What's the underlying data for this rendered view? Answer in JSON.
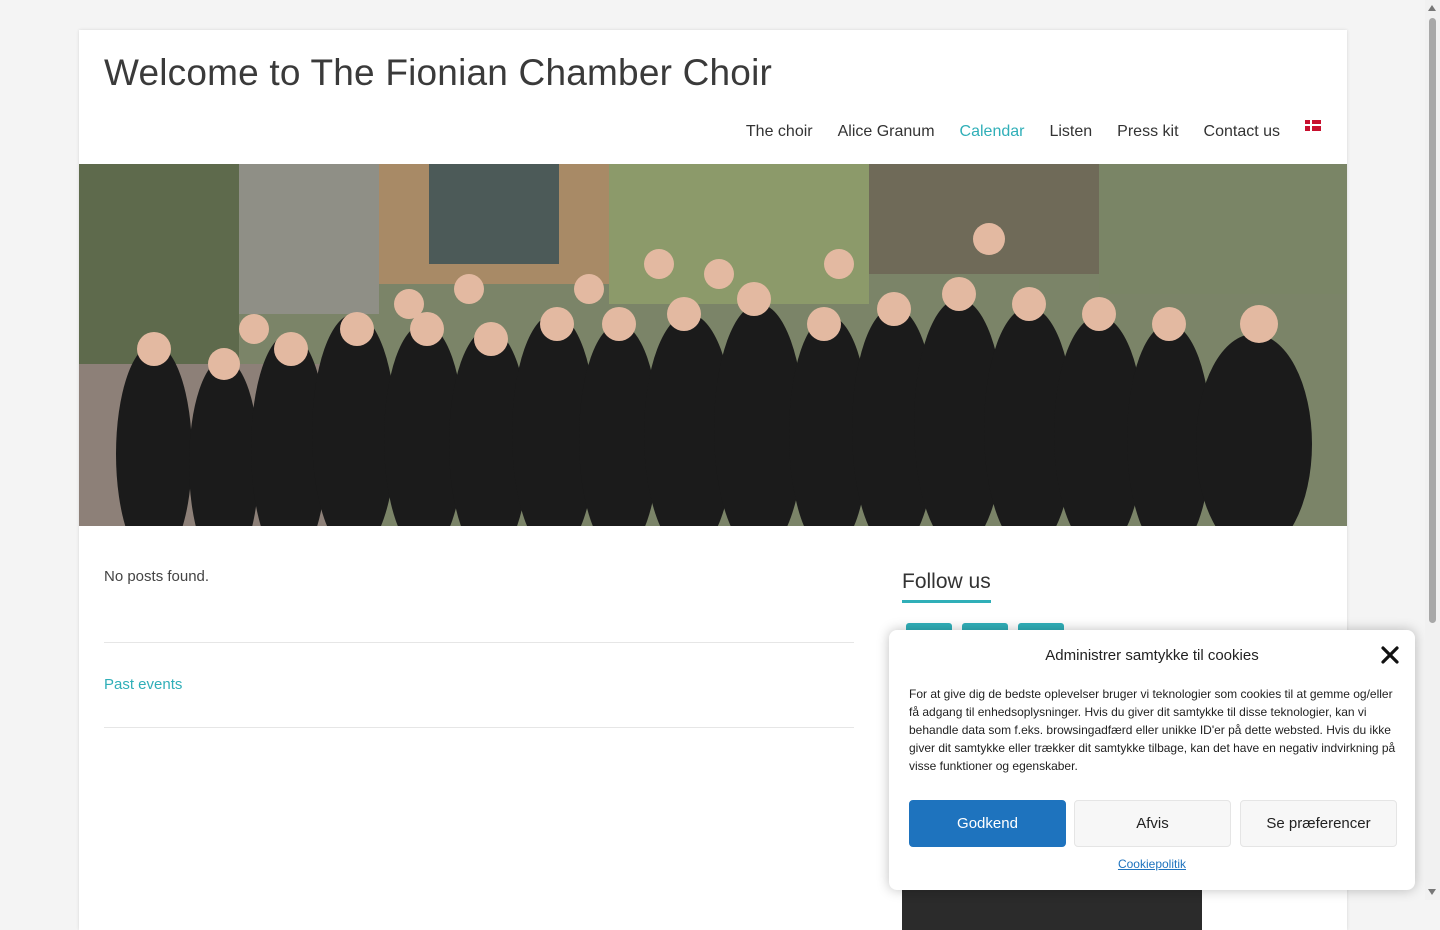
{
  "site": {
    "title": "Welcome to The Fionian Chamber Choir"
  },
  "nav": {
    "items": [
      {
        "label": "The choir"
      },
      {
        "label": "Alice Granum"
      },
      {
        "label": "Calendar",
        "active": true
      },
      {
        "label": "Listen"
      },
      {
        "label": "Press kit"
      },
      {
        "label": "Contact us"
      }
    ],
    "language_flag": "danish-flag-icon"
  },
  "main": {
    "no_posts": "No posts found.",
    "past_events": "Past events"
  },
  "sidebar": {
    "follow_title": "Follow us",
    "social_icons": [
      "facebook-icon",
      "instagram-icon",
      "youtube-icon"
    ]
  },
  "cookie": {
    "title": "Administrer samtykke til cookies",
    "text": "For at give dig de bedste oplevelser bruger vi teknologier som cookies til at gemme og/eller få adgang til enhedsoplysninger. Hvis du giver dit samtykke til disse teknologier, kan vi behandle data som f.eks. browsingadfærd eller unikke ID'er på dette websted. Hvis du ikke giver dit samtykke eller trækker dit samtykke tilbage, kan det have en negativ indvirkning på visse funktioner og egenskaber.",
    "accept": "Godkend",
    "deny": "Afvis",
    "preferences": "Se præferencer",
    "policy_link": "Cookiepolitik"
  },
  "colors": {
    "accent": "#30afb8",
    "button_primary": "#1e73be"
  }
}
